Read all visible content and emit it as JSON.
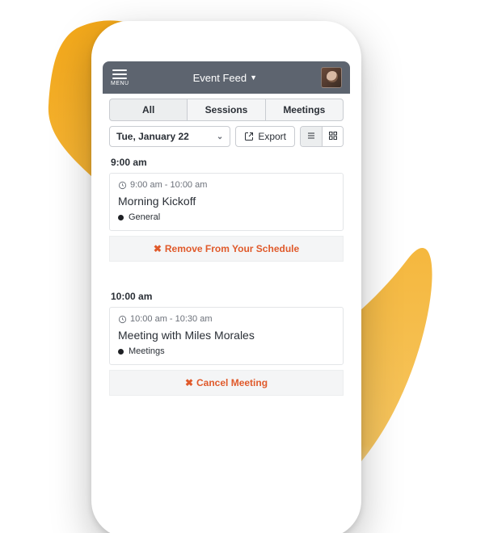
{
  "colors": {
    "accent": "#f3a81a",
    "action": "#e05a2b",
    "header": "#5d646f"
  },
  "header": {
    "menu_label": "MENU",
    "title": "Event Feed"
  },
  "tabs": {
    "all": "All",
    "sessions": "Sessions",
    "meetings": "Meetings"
  },
  "controls": {
    "date_label": "Tue, January 22",
    "export_label": "Export"
  },
  "sections": [
    {
      "time_heading": "9:00 am",
      "item": {
        "time_range": "9:00 am - 10:00 am",
        "title": "Morning Kickoff",
        "tag": "General"
      },
      "action_label": "Remove From Your Schedule"
    },
    {
      "time_heading": "10:00 am",
      "item": {
        "time_range": "10:00 am - 10:30 am",
        "title": "Meeting with Miles Morales",
        "tag": "Meetings"
      },
      "action_label": "Cancel Meeting"
    }
  ]
}
